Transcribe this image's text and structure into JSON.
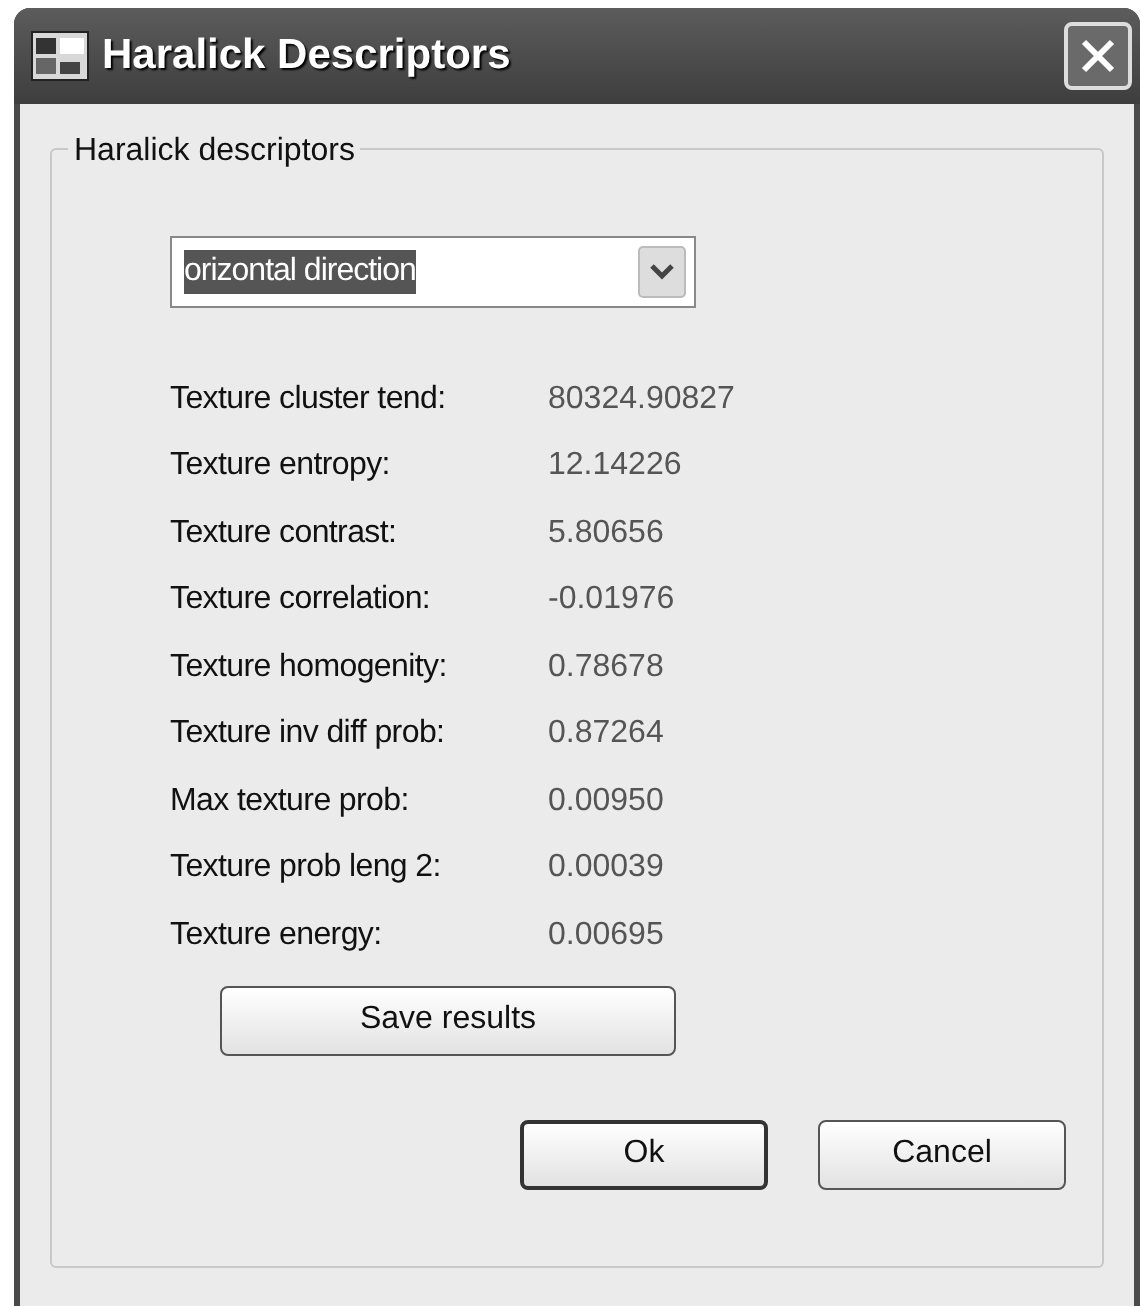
{
  "window": {
    "title": "Haralick Descriptors"
  },
  "group": {
    "title": "Haralick descriptors"
  },
  "direction": {
    "value": "orizontal direction"
  },
  "descriptors": [
    {
      "label": "Texture cluster tend:",
      "value": "80324.90827"
    },
    {
      "label": "Texture entropy:",
      "value": "12.14226"
    },
    {
      "label": "Texture contrast:",
      "value": "5.80656"
    },
    {
      "label": "Texture correlation:",
      "value": "-0.01976"
    },
    {
      "label": "Texture homogenity:",
      "value": "0.78678"
    },
    {
      "label": "Texture inv diff prob:",
      "value": "0.87264"
    },
    {
      "label": "Max texture prob:",
      "value": "0.00950"
    },
    {
      "label": "Texture prob leng 2:",
      "value": "0.00039"
    },
    {
      "label": "Texture energy:",
      "value": "0.00695"
    }
  ],
  "save_button": "Save results",
  "buttons": [
    {
      "label": "Ok",
      "default": true
    },
    {
      "label": "Cancel",
      "default": false
    }
  ]
}
